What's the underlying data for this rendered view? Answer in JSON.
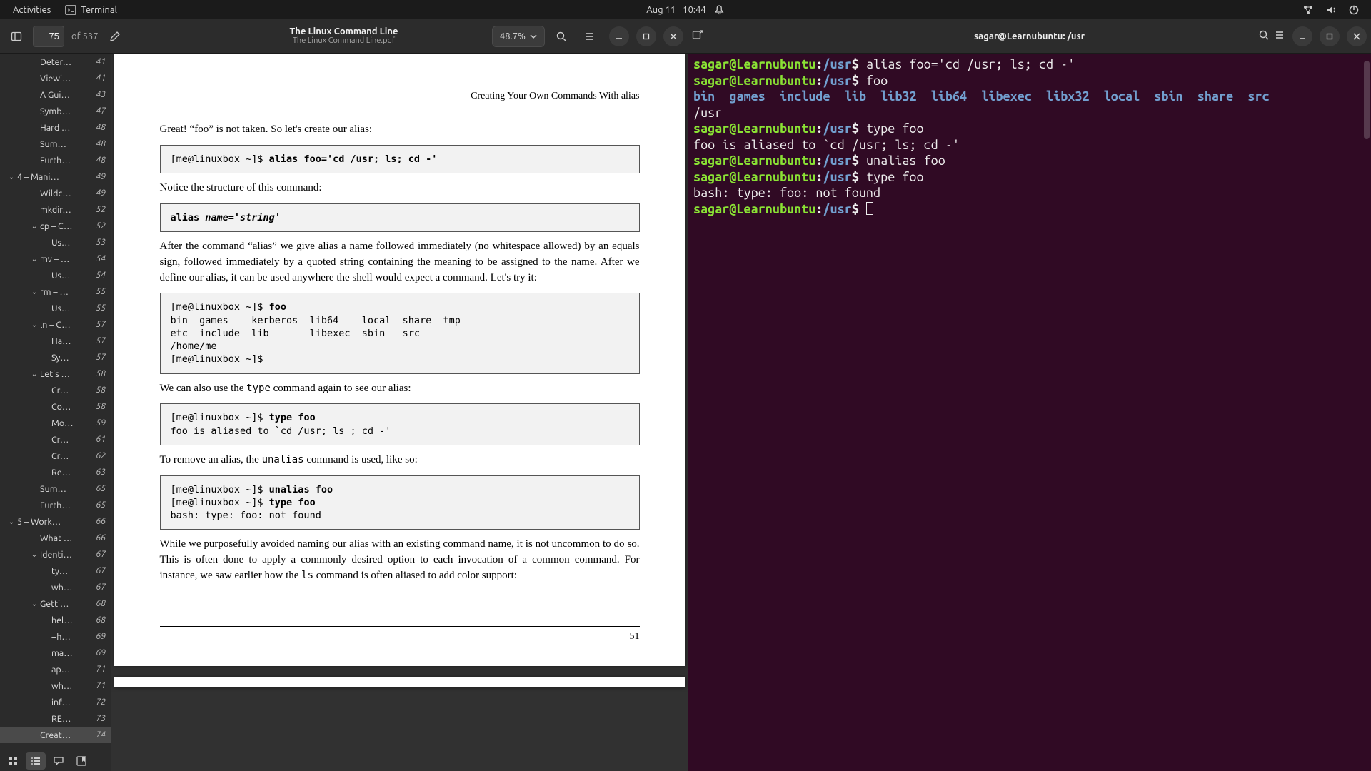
{
  "panel": {
    "activities": "Activities",
    "app_name": "Terminal",
    "date": "Aug 11",
    "time": "10:44"
  },
  "pdfviewer": {
    "title": "The Linux Command Line",
    "subtitle": "The Linux Command Line.pdf",
    "current_page": "75",
    "of_pages": "of 537",
    "zoom": "48.7%",
    "outline": [
      {
        "level": 3,
        "caret": false,
        "title": "Deter…",
        "page": "41"
      },
      {
        "level": 3,
        "caret": false,
        "title": "Viewi…",
        "page": "41"
      },
      {
        "level": 3,
        "caret": false,
        "title": "A Gui…",
        "page": "43"
      },
      {
        "level": 3,
        "caret": false,
        "title": "Symb…",
        "page": "47"
      },
      {
        "level": 3,
        "caret": false,
        "title": "Hard …",
        "page": "48"
      },
      {
        "level": 3,
        "caret": false,
        "title": "Sum…",
        "page": "48"
      },
      {
        "level": 3,
        "caret": false,
        "title": "Furth…",
        "page": "48"
      },
      {
        "level": 1,
        "caret": true,
        "title": "4 – Mani…",
        "page": "49"
      },
      {
        "level": 3,
        "caret": false,
        "title": "Wildc…",
        "page": "49"
      },
      {
        "level": 3,
        "caret": false,
        "title": "mkdir…",
        "page": "52"
      },
      {
        "level": 3,
        "caret": true,
        "title": "cp – C…",
        "page": "52"
      },
      {
        "level": 4,
        "caret": false,
        "title": "Us…",
        "page": "53"
      },
      {
        "level": 3,
        "caret": true,
        "title": "mv – …",
        "page": "54"
      },
      {
        "level": 4,
        "caret": false,
        "title": "Us…",
        "page": "54"
      },
      {
        "level": 3,
        "caret": true,
        "title": "rm – …",
        "page": "55"
      },
      {
        "level": 4,
        "caret": false,
        "title": "Us…",
        "page": "55"
      },
      {
        "level": 3,
        "caret": true,
        "title": "ln – C…",
        "page": "57"
      },
      {
        "level": 4,
        "caret": false,
        "title": "Ha…",
        "page": "57"
      },
      {
        "level": 4,
        "caret": false,
        "title": "Sy…",
        "page": "57"
      },
      {
        "level": 3,
        "caret": true,
        "title": "Let's …",
        "page": "58"
      },
      {
        "level": 4,
        "caret": false,
        "title": "Cr…",
        "page": "58"
      },
      {
        "level": 4,
        "caret": false,
        "title": "Co…",
        "page": "58"
      },
      {
        "level": 4,
        "caret": false,
        "title": "Mo…",
        "page": "59"
      },
      {
        "level": 4,
        "caret": false,
        "title": "Cr…",
        "page": "61"
      },
      {
        "level": 4,
        "caret": false,
        "title": "Cr…",
        "page": "62"
      },
      {
        "level": 4,
        "caret": false,
        "title": "Re…",
        "page": "63"
      },
      {
        "level": 3,
        "caret": false,
        "title": "Sum…",
        "page": "65"
      },
      {
        "level": 3,
        "caret": false,
        "title": "Furth…",
        "page": "65"
      },
      {
        "level": 1,
        "caret": true,
        "title": "5 – Work…",
        "page": "66"
      },
      {
        "level": 3,
        "caret": false,
        "title": "What …",
        "page": "66"
      },
      {
        "level": 3,
        "caret": true,
        "title": "Identi…",
        "page": "67"
      },
      {
        "level": 4,
        "caret": false,
        "title": "ty…",
        "page": "67"
      },
      {
        "level": 4,
        "caret": false,
        "title": "wh…",
        "page": "67"
      },
      {
        "level": 3,
        "caret": true,
        "title": "Getti…",
        "page": "68"
      },
      {
        "level": 4,
        "caret": false,
        "title": "hel…",
        "page": "68"
      },
      {
        "level": 4,
        "caret": false,
        "title": "--h…",
        "page": "69"
      },
      {
        "level": 4,
        "caret": false,
        "title": "ma…",
        "page": "69"
      },
      {
        "level": 4,
        "caret": false,
        "title": "ap…",
        "page": "71"
      },
      {
        "level": 4,
        "caret": false,
        "title": "wh…",
        "page": "71"
      },
      {
        "level": 4,
        "caret": false,
        "title": "inf…",
        "page": "72"
      },
      {
        "level": 4,
        "caret": false,
        "title": "RE…",
        "page": "73"
      },
      {
        "level": 3,
        "caret": false,
        "title": "Creat…",
        "page": "74",
        "selected": true
      }
    ],
    "page": {
      "running_head": "Creating Your Own Commands With alias",
      "para1": "Great! “foo” is not taken. So let's create our alias:",
      "code1_prefix": "[me@linuxbox ~]$ ",
      "code1_bold": "alias foo='cd /usr; ls; cd -'",
      "para2": "Notice the structure of this command:",
      "code2_bold": "alias ",
      "code2_italic": "name='string'",
      "para3": "After the command “alias” we give alias a name followed immediately (no whitespace allowed) by an equals sign, followed immediately by a quoted string containing the meaning to be assigned to the name. After we define our alias, it can be used anywhere the shell would expect a command. Let's try it:",
      "code3": "[me@linuxbox ~]$ foo\nbin  games    kerberos  lib64    local  share  tmp\netc  include  lib       libexec  sbin   src\n/home/me\n[me@linuxbox ~]$",
      "code3_bold_at": "foo",
      "para4a": "We can also use the ",
      "para4_tt": "type",
      "para4b": " command again to see our alias:",
      "code4": "[me@linuxbox ~]$ type foo\nfoo is aliased to `cd /usr; ls ; cd -'",
      "para5a": "To remove an alias, the ",
      "para5_tt": "unalias",
      "para5b": " command is used, like so:",
      "code5": "[me@linuxbox ~]$ unalias foo\n[me@linuxbox ~]$ type foo\nbash: type: foo: not found",
      "para6a": "While we purposefully avoided naming our alias with an existing command name, it is not uncommon to do so. This is often done to apply a commonly desired option to each invocation of a common command. For instance, we saw earlier how the ",
      "para6_tt": "ls",
      "para6b": " command is often aliased to add color support:",
      "page_number": "51"
    }
  },
  "terminal": {
    "title": "sagar@Learnubuntu: /usr",
    "prompt_user": "sagar@Learnubuntu",
    "prompt_sep": ":",
    "prompt_path": "/usr",
    "prompt_dollar": "$",
    "lines": [
      {
        "type": "prompt",
        "cmd": "alias foo='cd /usr; ls; cd -'"
      },
      {
        "type": "prompt",
        "cmd": "foo"
      },
      {
        "type": "ls",
        "items": [
          "bin",
          "games",
          "include",
          "lib",
          "lib32",
          "lib64",
          "libexec",
          "libx32",
          "local",
          "sbin",
          "share",
          "src"
        ]
      },
      {
        "type": "plain",
        "text": "/usr"
      },
      {
        "type": "prompt",
        "cmd": "type foo"
      },
      {
        "type": "plain",
        "text": "foo is aliased to `cd /usr; ls; cd -'"
      },
      {
        "type": "prompt",
        "cmd": "unalias foo"
      },
      {
        "type": "prompt",
        "cmd": "type foo"
      },
      {
        "type": "plain",
        "text": "bash: type: foo: not found"
      },
      {
        "type": "prompt",
        "cmd": "",
        "cursor": true
      }
    ]
  }
}
